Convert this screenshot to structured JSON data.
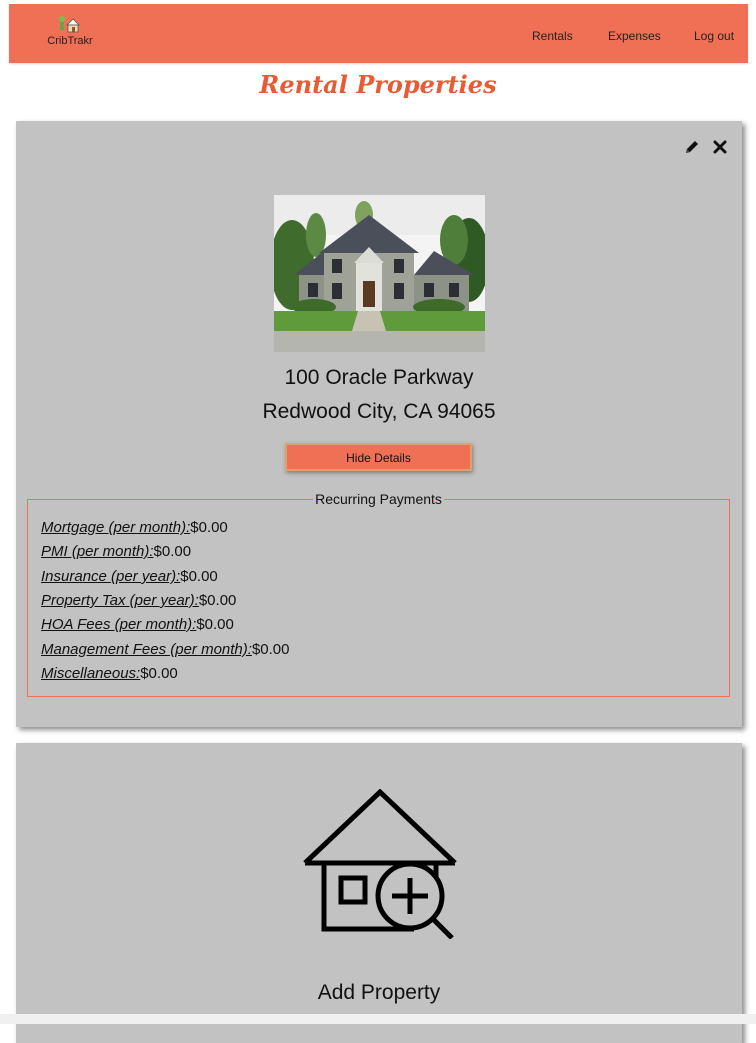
{
  "app": {
    "brand": "CribTrakr"
  },
  "nav": {
    "rentals": "Rentals",
    "expenses": "Expenses",
    "logout": "Log out"
  },
  "page": {
    "title": "Rental Properties"
  },
  "property": {
    "address_line1": "100 Oracle Parkway",
    "address_line2": "Redwood City, CA 94065",
    "hide_button": "Hide Details",
    "actions": {
      "edit_icon": "pencil-icon",
      "delete_icon": "close-icon"
    }
  },
  "recurring": {
    "title": "Recurring Payments",
    "items": [
      {
        "label": "Mortgage (per month):",
        "value": "$0.00"
      },
      {
        "label": "PMI (per month):",
        "value": "$0.00"
      },
      {
        "label": "Insurance (per year):",
        "value": "$0.00"
      },
      {
        "label": "Property Tax (per year):",
        "value": "$0.00"
      },
      {
        "label": "HOA Fees (per month):",
        "value": "$0.00"
      },
      {
        "label": "Management Fees (per month):",
        "value": "$0.00"
      },
      {
        "label": "Miscellaneous:",
        "value": "$0.00"
      }
    ]
  },
  "add_card": {
    "label": "Add Property",
    "icon": "house-add-icon"
  },
  "colors": {
    "accent": "#f07055",
    "title": "#ea5a34",
    "card": "#c2c2c2"
  }
}
